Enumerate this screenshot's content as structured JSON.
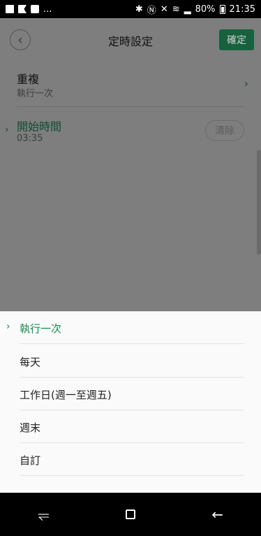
{
  "status_bar": {
    "left_icons": [
      "photo-icon",
      "flag-icon",
      "facebook-icon",
      "more-dots"
    ],
    "right_icons": [
      "bluetooth-icon",
      "nfc-icon",
      "mute-icon",
      "wifi-icon",
      "signal-icon"
    ],
    "battery_percent": "80%",
    "time": "21:35"
  },
  "header": {
    "title": "定時設定",
    "confirm_label": "確定"
  },
  "repeat": {
    "title": "重複",
    "value": "執行一次"
  },
  "start_time": {
    "title": "開始時間",
    "value": "03:35",
    "clear_label": "清除"
  },
  "sheet": {
    "options": [
      {
        "label": "執行一次",
        "selected": true
      },
      {
        "label": "每天",
        "selected": false
      },
      {
        "label": "工作日(週一至週五)",
        "selected": false
      },
      {
        "label": "週末",
        "selected": false
      },
      {
        "label": "自訂",
        "selected": false
      }
    ]
  },
  "colors": {
    "accent": "#1a8a55",
    "confirm_bg": "#17613f",
    "overlay": "#7e7e7e"
  }
}
